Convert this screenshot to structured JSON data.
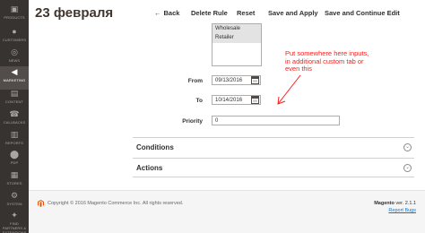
{
  "sidebar": {
    "items": [
      {
        "label": "PRODUCTS",
        "icon": "cube-icon"
      },
      {
        "label": "CUSTOMERS",
        "icon": "user-icon"
      },
      {
        "label": "NEWS",
        "icon": "globe-icon"
      },
      {
        "label": "MARKETING",
        "icon": "megaphone-icon"
      },
      {
        "label": "CONTENT",
        "icon": "layout-icon"
      },
      {
        "label": "CALLBACKS",
        "icon": "phone-icon"
      },
      {
        "label": "REPORTS",
        "icon": "bar-chart-icon"
      },
      {
        "label": "PDP",
        "icon": "pin-icon"
      },
      {
        "label": "STORES",
        "icon": "store-icon"
      },
      {
        "label": "SYSTEM",
        "icon": "gear-icon"
      },
      {
        "label": "FIND PARTNERS & EXTENSIONS",
        "icon": "puzzle-icon"
      }
    ]
  },
  "header": {
    "title": "23 февраля",
    "back_label": "Back",
    "delete_label": "Delete Rule",
    "reset_label": "Reset",
    "save_apply_label": "Save and Apply",
    "save_continue_label": "Save and Continue Edit"
  },
  "form": {
    "customer_groups": [
      "Wholesale",
      "Retailer"
    ],
    "from_label": "From",
    "from_value": "09/13/2016",
    "to_label": "To",
    "to_value": "10/14/2016",
    "priority_label": "Priority",
    "priority_value": "0"
  },
  "annotation": {
    "text": "Put somewhere here inputs, in additional custom tab or even this",
    "color": "#ff1a1a"
  },
  "sections": {
    "conditions": "Conditions",
    "actions": "Actions"
  },
  "footer": {
    "copyright": "Copyright © 2016 Magento Commerce Inc. All rights reserved.",
    "brand": "Magento",
    "version": " ver. 2.1.1",
    "report": "Report Bugs"
  },
  "colors": {
    "sidebar_bg": "#373330",
    "accent": "#eb5202",
    "link": "#007bdb"
  }
}
